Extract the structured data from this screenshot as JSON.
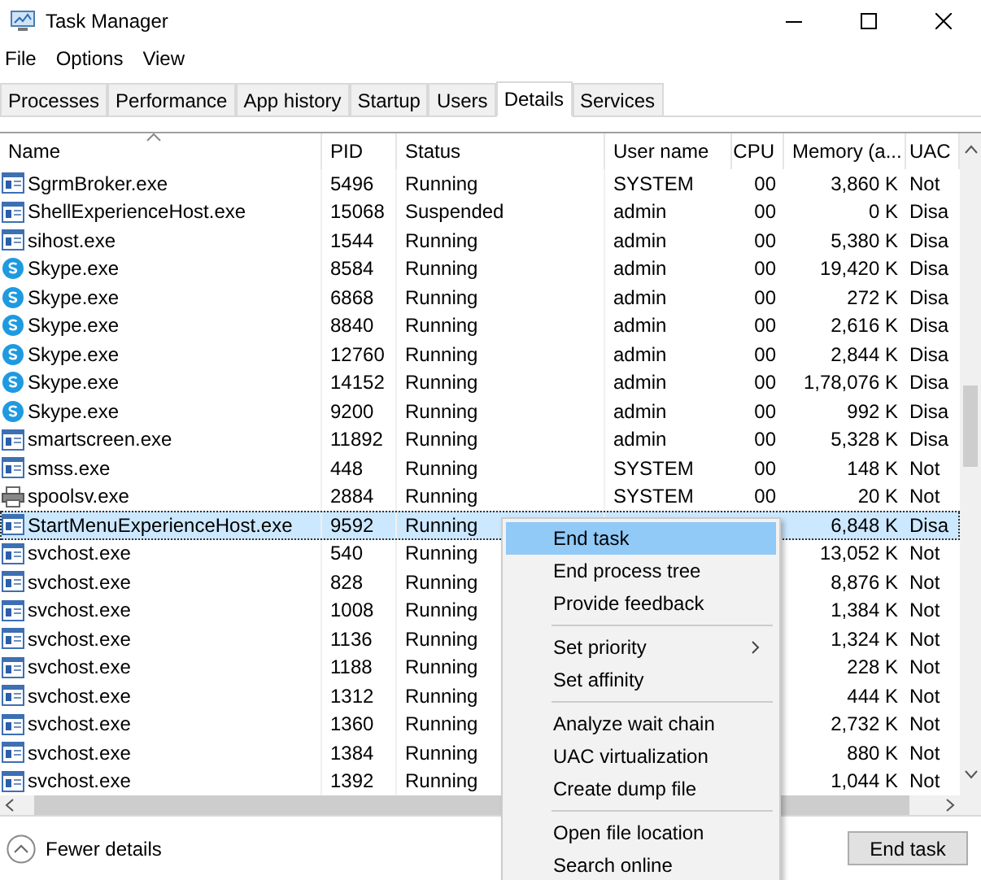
{
  "window": {
    "title": "Task Manager"
  },
  "menubar": [
    "File",
    "Options",
    "View"
  ],
  "tabs": [
    {
      "label": "Processes",
      "selected": false
    },
    {
      "label": "Performance",
      "selected": false
    },
    {
      "label": "App history",
      "selected": false
    },
    {
      "label": "Startup",
      "selected": false
    },
    {
      "label": "Users",
      "selected": false
    },
    {
      "label": "Details",
      "selected": true
    },
    {
      "label": "Services",
      "selected": false
    }
  ],
  "table": {
    "columns": [
      "Name",
      "PID",
      "Status",
      "User name",
      "CPU",
      "Memory (a...",
      "UAC"
    ],
    "rows": [
      {
        "kind": "app",
        "name": "SgrmBroker.exe",
        "pid": "5496",
        "status": "Running",
        "user": "SYSTEM",
        "cpu": "00",
        "memory": "3,860 K",
        "uac": "Not",
        "selected": false
      },
      {
        "kind": "app",
        "name": "ShellExperienceHost.exe",
        "pid": "15068",
        "status": "Suspended",
        "user": "admin",
        "cpu": "00",
        "memory": "0 K",
        "uac": "Disa",
        "selected": false
      },
      {
        "kind": "app",
        "name": "sihost.exe",
        "pid": "1544",
        "status": "Running",
        "user": "admin",
        "cpu": "00",
        "memory": "5,380 K",
        "uac": "Disa",
        "selected": false
      },
      {
        "kind": "skype",
        "name": "Skype.exe",
        "pid": "8584",
        "status": "Running",
        "user": "admin",
        "cpu": "00",
        "memory": "19,420 K",
        "uac": "Disa",
        "selected": false
      },
      {
        "kind": "skype",
        "name": "Skype.exe",
        "pid": "6868",
        "status": "Running",
        "user": "admin",
        "cpu": "00",
        "memory": "272 K",
        "uac": "Disa",
        "selected": false
      },
      {
        "kind": "skype",
        "name": "Skype.exe",
        "pid": "8840",
        "status": "Running",
        "user": "admin",
        "cpu": "00",
        "memory": "2,616 K",
        "uac": "Disa",
        "selected": false
      },
      {
        "kind": "skype",
        "name": "Skype.exe",
        "pid": "12760",
        "status": "Running",
        "user": "admin",
        "cpu": "00",
        "memory": "2,844 K",
        "uac": "Disa",
        "selected": false
      },
      {
        "kind": "skype",
        "name": "Skype.exe",
        "pid": "14152",
        "status": "Running",
        "user": "admin",
        "cpu": "00",
        "memory": "1,78,076 K",
        "uac": "Disa",
        "selected": false
      },
      {
        "kind": "skype",
        "name": "Skype.exe",
        "pid": "9200",
        "status": "Running",
        "user": "admin",
        "cpu": "00",
        "memory": "992 K",
        "uac": "Disa",
        "selected": false
      },
      {
        "kind": "app",
        "name": "smartscreen.exe",
        "pid": "11892",
        "status": "Running",
        "user": "admin",
        "cpu": "00",
        "memory": "5,328 K",
        "uac": "Disa",
        "selected": false
      },
      {
        "kind": "app",
        "name": "smss.exe",
        "pid": "448",
        "status": "Running",
        "user": "SYSTEM",
        "cpu": "00",
        "memory": "148 K",
        "uac": "Not",
        "selected": false
      },
      {
        "kind": "printer",
        "name": "spoolsv.exe",
        "pid": "2884",
        "status": "Running",
        "user": "SYSTEM",
        "cpu": "00",
        "memory": "20 K",
        "uac": "Not",
        "selected": false
      },
      {
        "kind": "app",
        "name": "StartMenuExperienceHost.exe",
        "pid": "9592",
        "status": "Running",
        "memory": "6,848 K",
        "uac": "Disa",
        "selected": true
      },
      {
        "kind": "app",
        "name": "svchost.exe",
        "pid": "540",
        "status": "Running",
        "memory": "13,052 K",
        "uac": "Not",
        "selected": false
      },
      {
        "kind": "app",
        "name": "svchost.exe",
        "pid": "828",
        "status": "Running",
        "memory": "8,876 K",
        "uac": "Not",
        "selected": false
      },
      {
        "kind": "app",
        "name": "svchost.exe",
        "pid": "1008",
        "status": "Running",
        "memory": "1,384 K",
        "uac": "Not",
        "selected": false
      },
      {
        "kind": "app",
        "name": "svchost.exe",
        "pid": "1136",
        "status": "Running",
        "memory": "1,324 K",
        "uac": "Not",
        "selected": false
      },
      {
        "kind": "app",
        "name": "svchost.exe",
        "pid": "1188",
        "status": "Running",
        "memory": "228 K",
        "uac": "Not",
        "selected": false
      },
      {
        "kind": "app",
        "name": "svchost.exe",
        "pid": "1312",
        "status": "Running",
        "memory": "444 K",
        "uac": "Not",
        "selected": false
      },
      {
        "kind": "app",
        "name": "svchost.exe",
        "pid": "1360",
        "status": "Running",
        "memory": "2,732 K",
        "uac": "Not",
        "selected": false
      },
      {
        "kind": "app",
        "name": "svchost.exe",
        "pid": "1384",
        "status": "Running",
        "memory": "880 K",
        "uac": "Not",
        "selected": false
      },
      {
        "kind": "app",
        "name": "svchost.exe",
        "pid": "1392",
        "status": "Running",
        "memory": "1,044 K",
        "uac": "Not",
        "selected": false
      }
    ]
  },
  "context_menu": {
    "groups": [
      [
        {
          "label": "End task",
          "selected": true,
          "submenu": false
        },
        {
          "label": "End process tree",
          "selected": false,
          "submenu": false
        },
        {
          "label": "Provide feedback",
          "selected": false,
          "submenu": false
        }
      ],
      [
        {
          "label": "Set priority",
          "selected": false,
          "submenu": true
        },
        {
          "label": "Set affinity",
          "selected": false,
          "submenu": false
        }
      ],
      [
        {
          "label": "Analyze wait chain",
          "selected": false,
          "submenu": false
        },
        {
          "label": "UAC virtualization",
          "selected": false,
          "submenu": false
        },
        {
          "label": "Create dump file",
          "selected": false,
          "submenu": false
        }
      ],
      [
        {
          "label": "Open file location",
          "selected": false,
          "submenu": false
        },
        {
          "label": "Search online",
          "selected": false,
          "submenu": false
        }
      ]
    ]
  },
  "footer": {
    "toggle": "Fewer details",
    "button": "End task"
  }
}
